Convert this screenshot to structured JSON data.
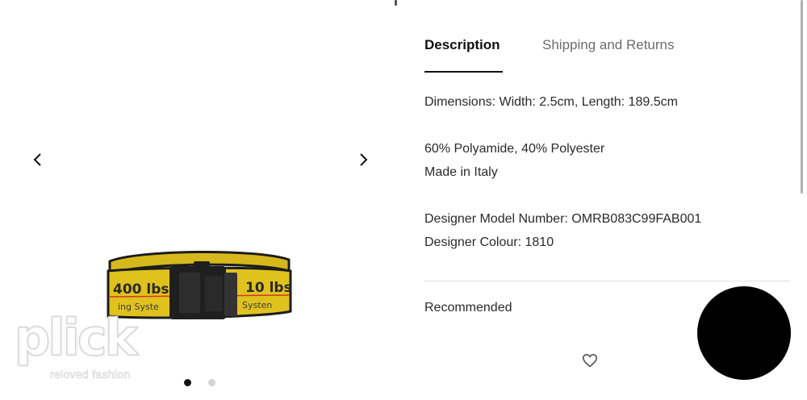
{
  "gallery": {
    "prev_icon": "chevron-left-icon",
    "next_icon": "chevron-right-icon",
    "image_label": "yellow industrial belt with black buckle",
    "belt_text_left": "400 lbs",
    "belt_text_right": "10 lbs",
    "belt_sub_left": "ing Syste",
    "belt_sub_right": "Systen",
    "dots": [
      {
        "active": true
      },
      {
        "active": false
      }
    ],
    "colors": {
      "belt_yellow": "#e0c21f",
      "belt_dark": "#1c1c1c",
      "belt_stripe": "#d23a1e"
    }
  },
  "watermark": {
    "logo": "plick",
    "tagline": "reloved fashion"
  },
  "tabs": {
    "description": "Description",
    "shipping": "Shipping and Returns"
  },
  "details": {
    "dimensions": "Dimensions: Width: 2.5cm, Length: 189.5cm",
    "composition": "60% Polyamide, 40% Polyester",
    "origin": "Made in Italy",
    "model_number": "Designer Model Number: OMRB083C99FAB001",
    "colour": "Designer Colour: 1810"
  },
  "recommended": {
    "title": "Recommended",
    "wishlist_icon": "heart-outline-icon"
  }
}
